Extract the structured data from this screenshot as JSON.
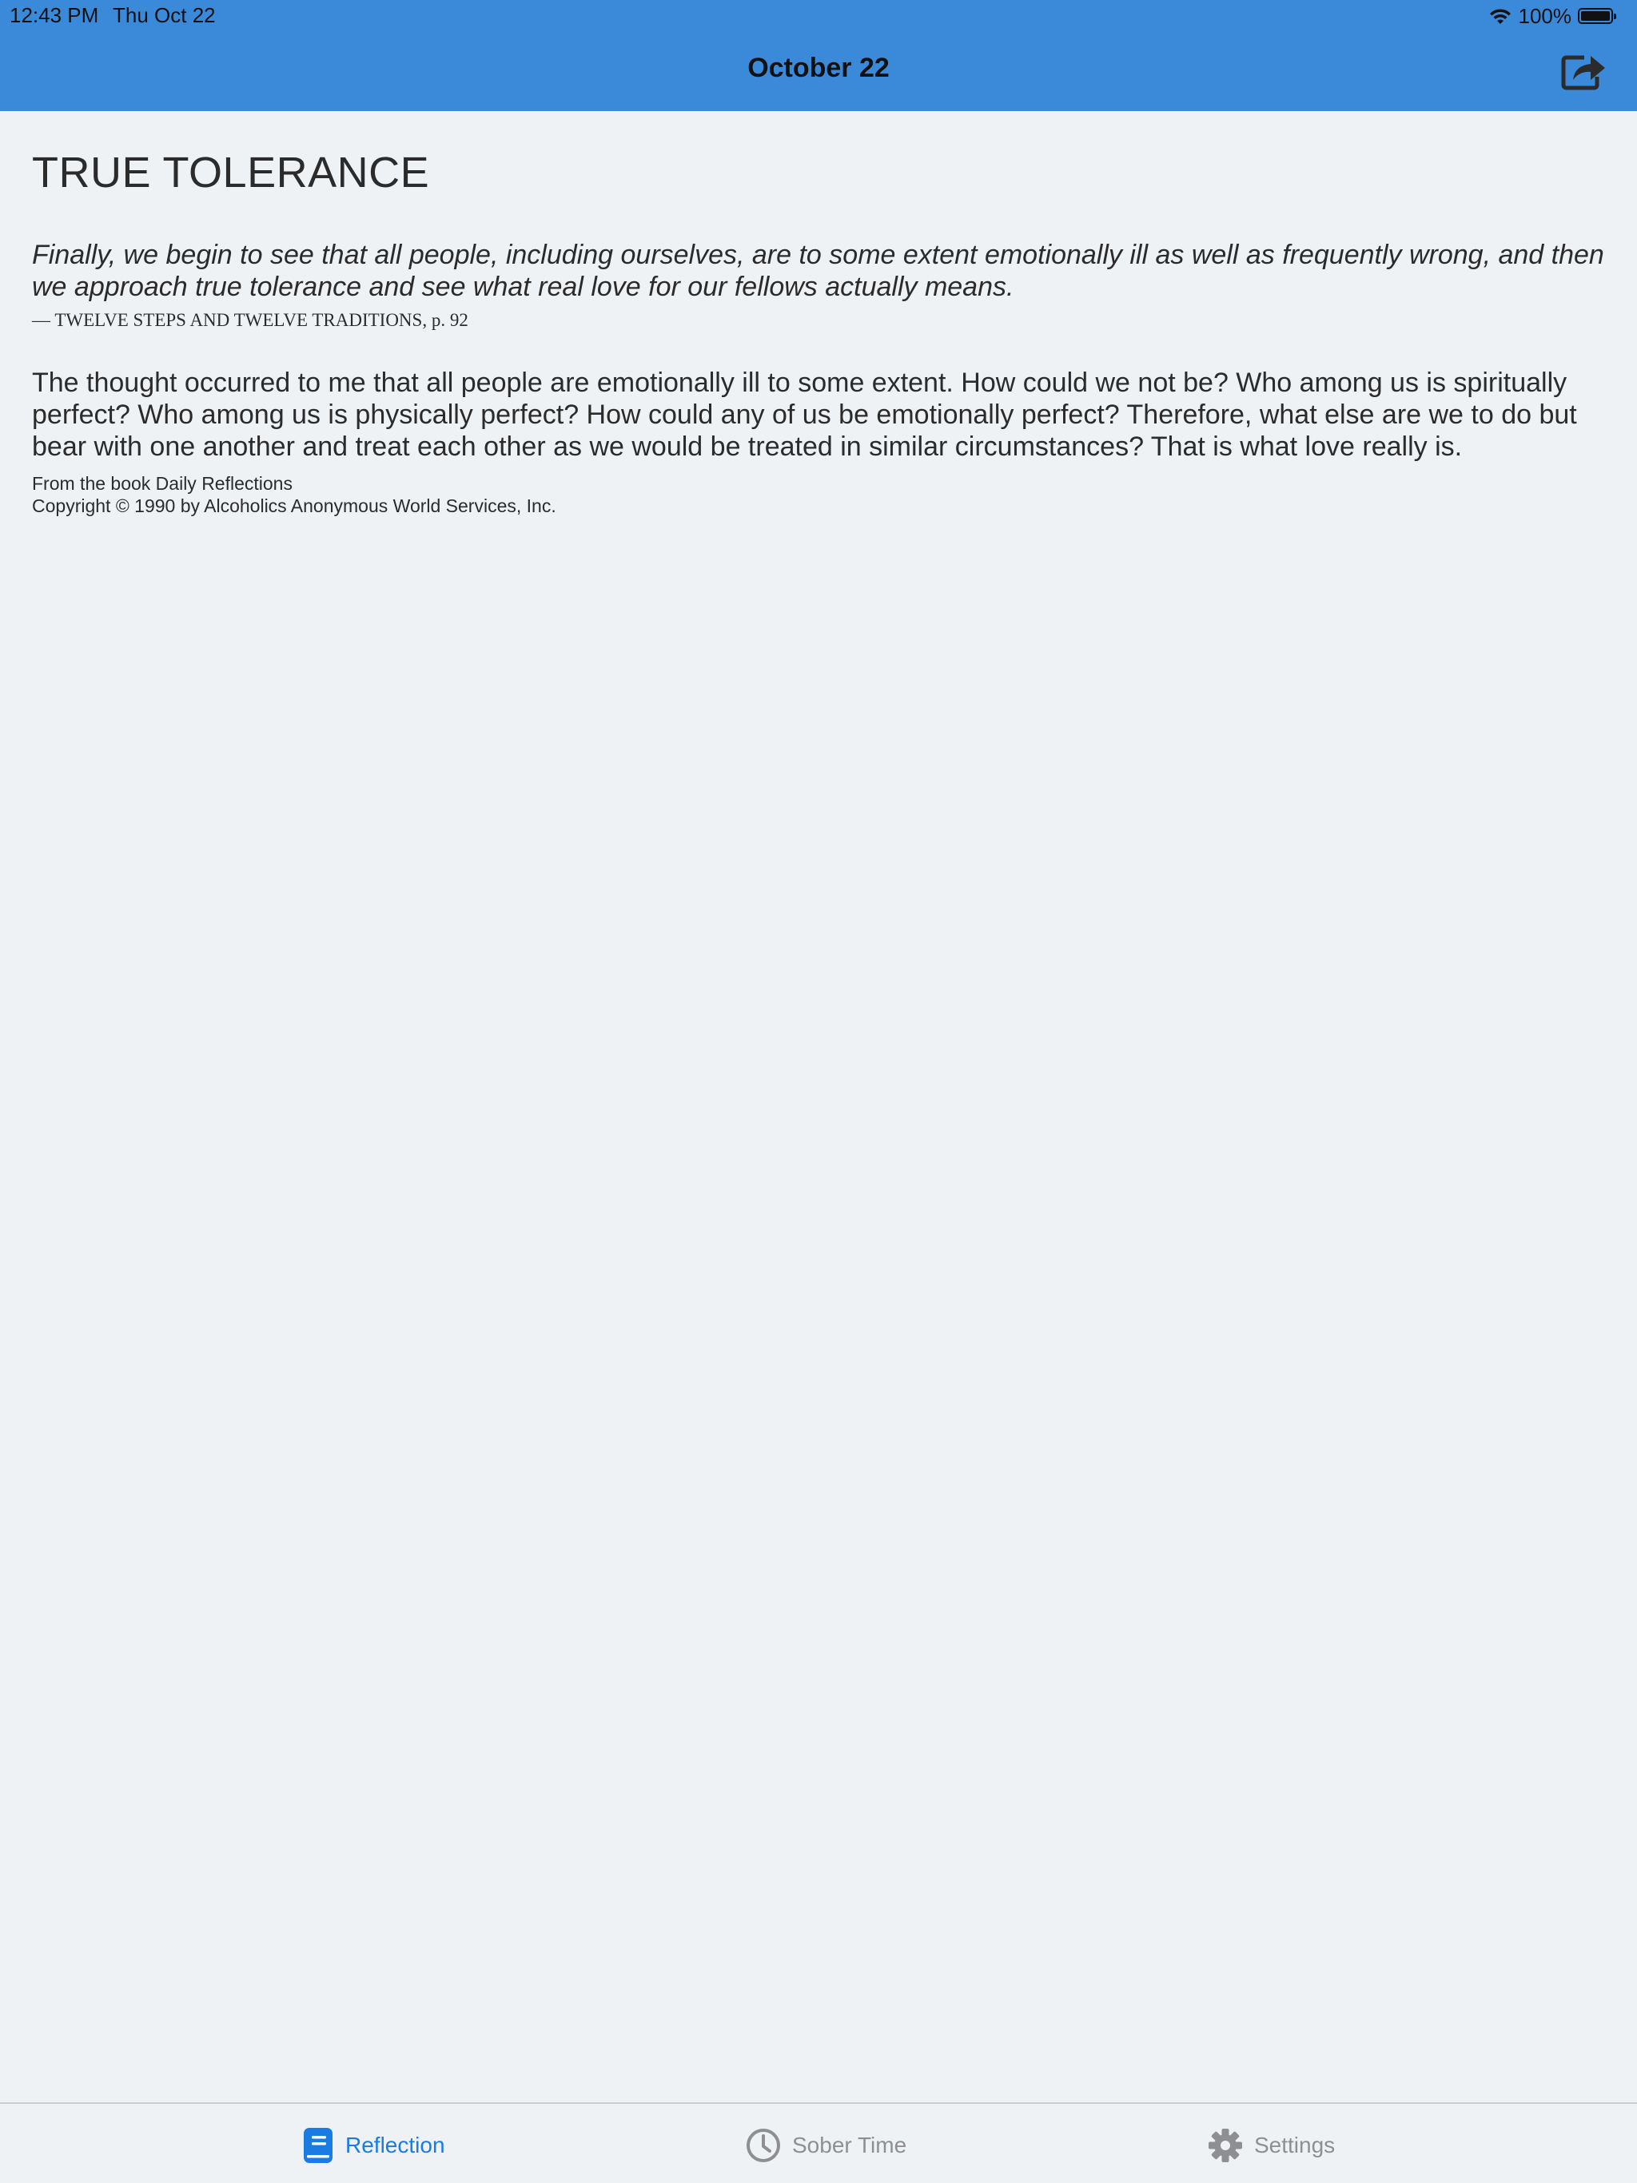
{
  "status_bar": {
    "time": "12:43 PM",
    "date": "Thu Oct 22",
    "battery": "100%",
    "battery_level": 1.0
  },
  "nav_bar": {
    "title": "October 22",
    "share_icon": "share-icon"
  },
  "reflection": {
    "title": "TRUE TOLERANCE",
    "quote": "Finally, we begin to see that all people, including ourselves, are to some extent emotionally ill as well as frequently wrong, and then we approach true tolerance and see what real love for our fellows actually means.",
    "quote_source": "— TWELVE STEPS AND TWELVE TRADITIONS, p. 92",
    "body": "The thought occurred to me that all people are emotionally ill to some extent. How could we not be? Who among us is spiritually perfect? Who among us is physically perfect? How could any of us be emotionally perfect? Therefore, what else are we to do but bear with one another and treat each other as we would be treated in similar circumstances? That is what love really is.",
    "attribution_line1": "From the book Daily Reflections",
    "attribution_line2": "Copyright © 1990 by Alcoholics Anonymous World Services, Inc."
  },
  "tab_bar": {
    "tabs": [
      {
        "label": "Reflection",
        "icon": "book-icon",
        "selected": true
      },
      {
        "label": "Sober Time",
        "icon": "clock-icon",
        "selected": false
      },
      {
        "label": "Settings",
        "icon": "gear-icon",
        "selected": false
      }
    ]
  },
  "colors": {
    "header_blue": "#3b8ad9",
    "background": "#eff2f5",
    "tab_active": "#1a7be2",
    "tab_inactive": "#8e8e93"
  }
}
